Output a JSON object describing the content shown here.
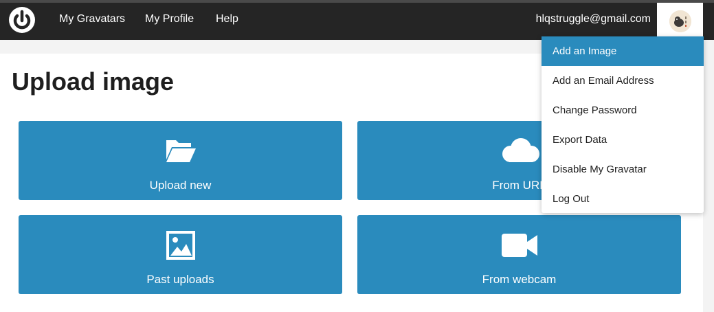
{
  "header": {
    "nav": [
      "My Gravatars",
      "My Profile",
      "Help"
    ],
    "email": "hlqstruggle@gmail.com"
  },
  "page": {
    "title": "Upload image"
  },
  "tiles": [
    {
      "label": "Upload new",
      "icon": "folder-open-icon"
    },
    {
      "label": "From URL",
      "icon": "cloud-icon"
    },
    {
      "label": "Past uploads",
      "icon": "image-icon"
    },
    {
      "label": "From webcam",
      "icon": "video-camera-icon"
    }
  ],
  "dropdown": {
    "items": [
      "Add an Image",
      "Add an Email Address",
      "Change Password",
      "Export Data",
      "Disable My Gravatar",
      "Log Out"
    ],
    "active_index": 0
  },
  "colors": {
    "header_bg": "#252525",
    "accent": "#2a8bbd",
    "content_bg": "#ffffff",
    "page_bg": "#f3f3f3"
  }
}
